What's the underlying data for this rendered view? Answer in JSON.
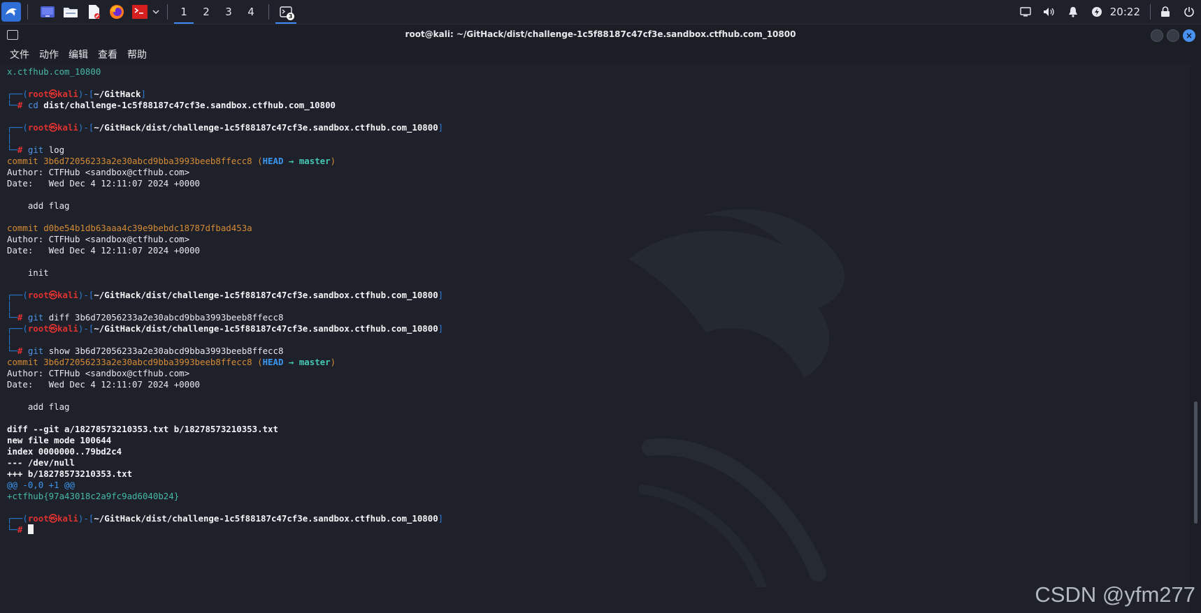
{
  "taskbar": {
    "workspaces": [
      "1",
      "2",
      "3",
      "4"
    ],
    "active_workspace": "1",
    "terminal_badge": "3",
    "clock": "20:22",
    "icons": [
      "kali-menu-icon",
      "desktop-icon",
      "file-manager-icon",
      "text-editor-icon",
      "firefox-icon",
      "terminal-launcher-icon",
      "dropdown-icon"
    ],
    "tray_icons": [
      "display-icon",
      "volume-icon",
      "notification-bell-icon",
      "power-icon",
      "lock-icon",
      "logout-icon"
    ]
  },
  "window": {
    "title": "root@kali: ~/GitHack/dist/challenge-1c5f88187c47cf3e.sandbox.ctfhub.com_10800"
  },
  "menu": [
    "文件",
    "动作",
    "编辑",
    "查看",
    "帮助"
  ],
  "prompt": {
    "user": "root",
    "host": "kali",
    "sym": "㉿",
    "path_home": "~/GitHack",
    "path_repo": "~/GitHack/dist/challenge-1c5f88187c47cf3e.sandbox.ctfhub.com_10800"
  },
  "terminal": {
    "line_top": "x.ctfhub.com_10800",
    "cmd_cd": "cd",
    "cmd_cd_arg": "dist/challenge-1c5f88187c47cf3e.sandbox.ctfhub.com_10800",
    "cmd_git": "git",
    "arg_log": "log",
    "arg_diff": "diff 3b6d72056233a2e30abcd9bba3993beeb8ffecc8",
    "arg_show": "show 3b6d72056233a2e30abcd9bba3993beeb8ffecc8",
    "commit1": "commit 3b6d72056233a2e30abcd9bba3993beeb8ffecc8",
    "head": "HEAD",
    "arrow": "→",
    "master": "master",
    "author": "Author: CTFHub <sandbox@ctfhub.com>",
    "date": "Date:   Wed Dec 4 12:11:07 2024 +0000",
    "msg_add_flag": "    add flag",
    "commit2": "commit d0be54b1db63aaa4c39e9bebdc18787dfbad453a",
    "msg_init": "    init",
    "diff_header": "diff --git a/18278573210353.txt b/18278573210353.txt",
    "diff_mode": "new file mode 100644",
    "diff_index": "index 0000000..79bd2c4",
    "diff_minus": "--- /dev/null",
    "diff_plus": "+++ b/18278573210353.txt",
    "diff_hunk": "@@ -0,0 +1 @@",
    "diff_flag": "+ctfhub{97a43018c2a9fc9ad6040b24}"
  },
  "watermark": "CSDN @yfm277"
}
